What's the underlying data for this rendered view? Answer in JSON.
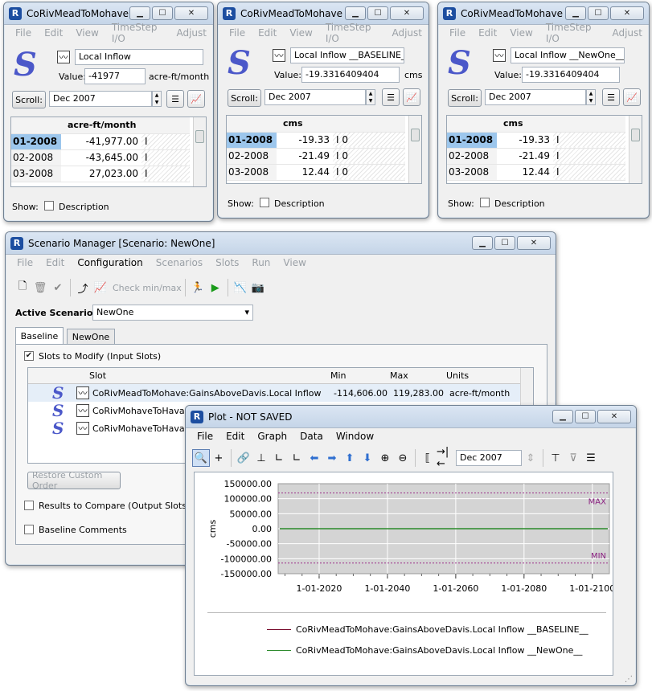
{
  "slot_windows": [
    {
      "title": "CoRivMeadToMohave...",
      "menu": [
        "File",
        "Edit",
        "View",
        "TimeStep I/O",
        "Adjust"
      ],
      "slot_name": "Local Inflow",
      "value_label": "Value:",
      "value": "-41977",
      "units": "acre-ft/month",
      "scroll_label": "Scroll:",
      "scroll_date": "Dec 2007",
      "col_header": "acre-ft/month",
      "rows": [
        {
          "date": "01-2008",
          "value": "-41,977.00",
          "flag": "I",
          "flag2": ""
        },
        {
          "date": "02-2008",
          "value": "-43,645.00",
          "flag": "I",
          "flag2": ""
        },
        {
          "date": "03-2008",
          "value": "27,023.00",
          "flag": "I",
          "flag2": ""
        }
      ],
      "show_label": "Show:",
      "desc_label": "Description"
    },
    {
      "title": "CoRivMeadToMohave",
      "menu": [
        "File",
        "Edit",
        "View",
        "TimeStep I/O",
        "Adjust"
      ],
      "slot_name": "Local Inflow __BASELINE__",
      "value_label": "Value:",
      "value": "-19.3316409404",
      "units": "cms",
      "scroll_label": "Scroll:",
      "scroll_date": "Dec 2007",
      "col_header": "cms",
      "rows": [
        {
          "date": "01-2008",
          "value": "-19.33",
          "flag": "I",
          "flag2": "0"
        },
        {
          "date": "02-2008",
          "value": "-21.49",
          "flag": "I",
          "flag2": "0"
        },
        {
          "date": "03-2008",
          "value": "12.44",
          "flag": "I",
          "flag2": "0"
        }
      ],
      "show_label": "Show:",
      "desc_label": "Description"
    },
    {
      "title": "CoRivMeadToMohave",
      "menu": [
        "File",
        "Edit",
        "View",
        "TimeStep I/O",
        "Adjust"
      ],
      "slot_name": "Local Inflow __NewOne__",
      "value_label": "Value:",
      "value": "-19.3316409404",
      "units": "cms",
      "scroll_label": "Scroll:",
      "scroll_date": "Dec 2007",
      "col_header": "cms",
      "rows": [
        {
          "date": "01-2008",
          "value": "-19.33",
          "flag": "I",
          "flag2": ""
        },
        {
          "date": "02-2008",
          "value": "-21.49",
          "flag": "I",
          "flag2": ""
        },
        {
          "date": "03-2008",
          "value": "12.44",
          "flag": "I",
          "flag2": ""
        }
      ],
      "show_label": "Show:",
      "desc_label": "Description"
    }
  ],
  "scenario": {
    "title": "Scenario Manager [Scenario: NewOne]",
    "menu": [
      "File",
      "Edit",
      "Configuration",
      "Scenarios",
      "Slots",
      "Run",
      "View"
    ],
    "check_label": "Check min/max",
    "active_label": "Active Scenario:",
    "active_value": "NewOne",
    "tabs": [
      "Baseline",
      "NewOne"
    ],
    "slots_label": "Slots to Modify (Input Slots)",
    "columns": {
      "slot": "Slot",
      "min": "Min",
      "max": "Max",
      "units": "Units"
    },
    "rows": [
      {
        "slot": "CoRivMeadToMohave:GainsAboveDavis.Local Inflow",
        "min": "-114,606.00",
        "max": "119,283.00",
        "units": "acre-ft/month"
      },
      {
        "slot": "CoRivMohaveToHavasu",
        "min": "",
        "max": "",
        "units": ""
      },
      {
        "slot": "CoRivMohaveToHavasu",
        "min": "",
        "max": "",
        "units": ""
      }
    ],
    "restore_label": "Restore Custom Order",
    "results_label": "Results to Compare (Output Slots)",
    "comments_label": "Baseline Comments"
  },
  "plot": {
    "title": "Plot - NOT SAVED",
    "menu": [
      "File",
      "Edit",
      "Graph",
      "Data",
      "Window"
    ],
    "date": "Dec 2007",
    "legend": [
      {
        "label": "CoRivMeadToMohave:GainsAboveDavis.Local Inflow __BASELINE__",
        "color": "#7a1030"
      },
      {
        "label": "CoRivMeadToMohave:GainsAboveDavis.Local Inflow __NewOne__",
        "color": "#2a8a2a"
      }
    ]
  },
  "chart_data": {
    "type": "line",
    "ylabel": "cms",
    "yticks": [
      "150000.00",
      "100000.00",
      "50000.00",
      "0.00",
      "-50000.00",
      "-100000.00",
      "-150000.00"
    ],
    "ylim": [
      -150000,
      150000
    ],
    "xticks": [
      "1-01-2020",
      "1-01-2040",
      "1-01-2060",
      "1-01-2080",
      "1-01-2100"
    ],
    "xrange": [
      2008,
      2105
    ],
    "max_line": {
      "label": "MAX",
      "value": 119283
    },
    "min_line": {
      "label": "MIN",
      "value": -114606
    },
    "series": [
      {
        "name": "__BASELINE__",
        "color": "#7a1030",
        "value": 0
      },
      {
        "name": "__NewOne__",
        "color": "#2a8a2a",
        "value": 0
      }
    ]
  }
}
